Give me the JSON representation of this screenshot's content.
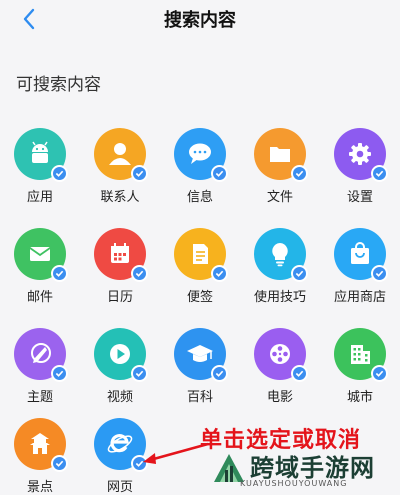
{
  "header": {
    "title": "搜索内容",
    "back_icon": "chevron-left-icon"
  },
  "section": {
    "title": "可搜索内容"
  },
  "items": [
    {
      "key": "app",
      "label": "应用",
      "color": "#2ec2b2",
      "icon": "android-icon"
    },
    {
      "key": "contacts",
      "label": "联系人",
      "color": "#f5a623",
      "icon": "person-icon"
    },
    {
      "key": "messages",
      "label": "信息",
      "color": "#2e9ef4",
      "icon": "chat-bubble-icon"
    },
    {
      "key": "files",
      "label": "文件",
      "color": "#f59a2f",
      "icon": "folder-icon"
    },
    {
      "key": "settings",
      "label": "设置",
      "color": "#8d5bf0",
      "icon": "gear-icon"
    },
    {
      "key": "mail",
      "label": "邮件",
      "color": "#3fc262",
      "icon": "envelope-icon"
    },
    {
      "key": "calendar",
      "label": "日历",
      "color": "#ef4a43",
      "icon": "calendar-icon"
    },
    {
      "key": "notes",
      "label": "便签",
      "color": "#f7b21e",
      "icon": "note-icon"
    },
    {
      "key": "tips",
      "label": "使用技巧",
      "color": "#23b5e8",
      "icon": "lightbulb-icon"
    },
    {
      "key": "store",
      "label": "应用商店",
      "color": "#29a8f5",
      "icon": "shopping-bag-icon"
    },
    {
      "key": "themes",
      "label": "主题",
      "color": "#9b63ee",
      "icon": "paintbrush-icon"
    },
    {
      "key": "video",
      "label": "视频",
      "color": "#24c0b6",
      "icon": "play-icon"
    },
    {
      "key": "wiki",
      "label": "百科",
      "color": "#2e93f0",
      "icon": "graduation-cap-icon"
    },
    {
      "key": "movies",
      "label": "电影",
      "color": "#9a5ef0",
      "icon": "film-reel-icon"
    },
    {
      "key": "city",
      "label": "城市",
      "color": "#3cc25c",
      "icon": "building-icon"
    },
    {
      "key": "scenic",
      "label": "景点",
      "color": "#f58a25",
      "icon": "pagoda-icon"
    },
    {
      "key": "web",
      "label": "网页",
      "color": "#2b9af3",
      "icon": "browser-e-icon"
    }
  ],
  "check_color": "#3b8ef0",
  "annotation": {
    "text": "单击选定或取消",
    "color": "#e4141b"
  },
  "watermark": {
    "main": "跨域手游网",
    "sub": "KUAYUSHOUYOUWANG"
  }
}
